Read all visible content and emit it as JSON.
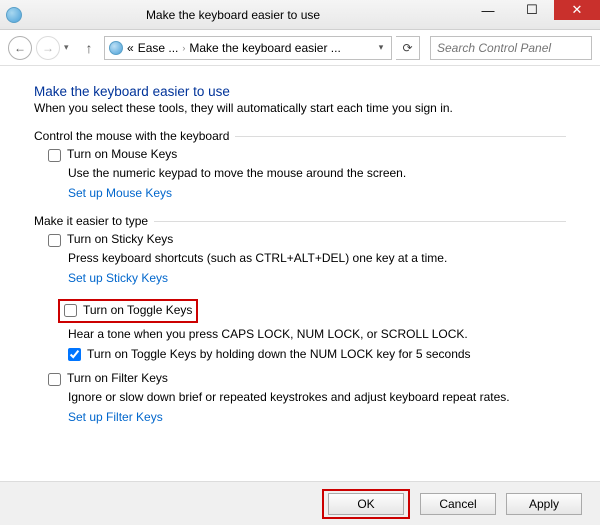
{
  "titlebar": {
    "title": "Make the keyboard easier to use"
  },
  "nav": {
    "crumb_prefix": "«",
    "crumb_a": "Ease ...",
    "crumb_b": "Make the keyboard easier ...",
    "search_placeholder": "Search Control Panel"
  },
  "heading": "Make the keyboard easier to use",
  "subhead": "When you select these tools, they will automatically start each time you sign in.",
  "section_mouse": {
    "title": "Control the mouse with the keyboard",
    "mouse_keys": {
      "label": "Turn on Mouse Keys",
      "checked": false
    },
    "mouse_keys_desc": "Use the numeric keypad to move the mouse around the screen.",
    "link": "Set up Mouse Keys"
  },
  "section_type": {
    "title": "Make it easier to type",
    "sticky": {
      "label": "Turn on Sticky Keys",
      "checked": false
    },
    "sticky_desc": "Press keyboard shortcuts (such as CTRL+ALT+DEL) one key at a time.",
    "sticky_link": "Set up Sticky Keys",
    "toggle": {
      "label": "Turn on Toggle Keys",
      "checked": false
    },
    "toggle_desc": "Hear a tone when you press CAPS LOCK, NUM LOCK, or SCROLL LOCK.",
    "toggle_sub": {
      "label": "Turn on Toggle Keys by holding down the NUM LOCK key for 5 seconds",
      "checked": true
    },
    "filter": {
      "label": "Turn on Filter Keys",
      "checked": false
    },
    "filter_desc": "Ignore or slow down brief or repeated keystrokes and adjust keyboard repeat rates.",
    "filter_link": "Set up Filter Keys"
  },
  "footer": {
    "ok": "OK",
    "cancel": "Cancel",
    "apply": "Apply"
  }
}
